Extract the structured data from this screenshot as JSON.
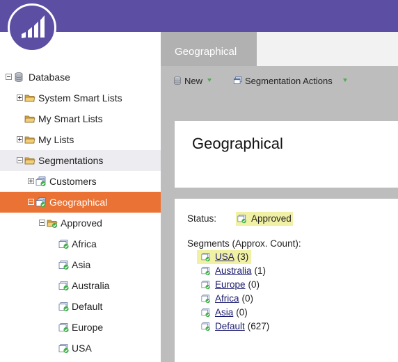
{
  "header": {
    "logo_icon": "marketo-bars-icon",
    "brand_color": "#5c4fa3"
  },
  "sidebar": {
    "selected_color": "#ea7234",
    "items": [
      {
        "label": "Database",
        "icon": "database-icon",
        "expander": "minus"
      },
      {
        "label": "System Smart Lists",
        "icon": "folder-icon",
        "expander": "plus"
      },
      {
        "label": "My Smart Lists",
        "icon": "folder-icon",
        "expander": "none"
      },
      {
        "label": "My Lists",
        "icon": "folder-icon",
        "expander": "plus"
      },
      {
        "label": "Segmentations",
        "icon": "folder-icon",
        "expander": "minus"
      },
      {
        "label": "Customers",
        "icon": "segmentation-icon",
        "expander": "plus"
      },
      {
        "label": "Geographical",
        "icon": "segmentation-icon",
        "expander": "minus"
      },
      {
        "label": "Approved",
        "icon": "approved-folder-icon",
        "expander": "minus"
      },
      {
        "label": "Africa",
        "icon": "segment-icon",
        "expander": "none"
      },
      {
        "label": "Asia",
        "icon": "segment-icon",
        "expander": "none"
      },
      {
        "label": "Australia",
        "icon": "segment-icon",
        "expander": "none"
      },
      {
        "label": "Default",
        "icon": "segment-icon",
        "expander": "none"
      },
      {
        "label": "Europe",
        "icon": "segment-icon",
        "expander": "none"
      },
      {
        "label": "USA",
        "icon": "segment-icon",
        "expander": "none"
      }
    ]
  },
  "tab": {
    "label": "Geographical"
  },
  "toolbar": {
    "new_label": "New",
    "new_icon": "database-icon",
    "actions_label": "Segmentation Actions",
    "actions_icon": "segmentation-actions-icon"
  },
  "detail": {
    "title": "Geographical",
    "status_label": "Status:",
    "status_value": "Approved",
    "status_icon": "approved-icon",
    "segments_title": "Segments (Approx. Count):",
    "segments": [
      {
        "name": "USA",
        "count": "(3)",
        "highlighted": true
      },
      {
        "name": "Australia",
        "count": "(1)",
        "highlighted": false
      },
      {
        "name": "Europe",
        "count": "(0)",
        "highlighted": false
      },
      {
        "name": "Africa",
        "count": "(0)",
        "highlighted": false
      },
      {
        "name": "Asia",
        "count": "(0)",
        "highlighted": false
      },
      {
        "name": "Default",
        "count": "(627)",
        "highlighted": false
      }
    ]
  }
}
